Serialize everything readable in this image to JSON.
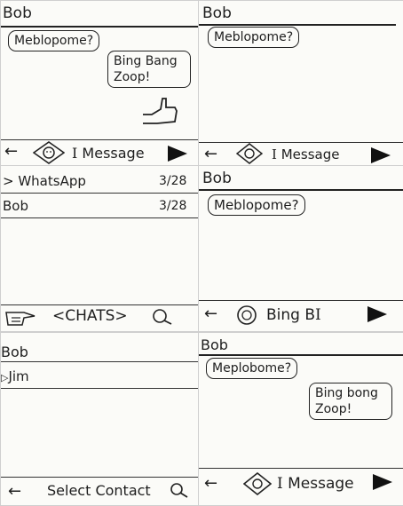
{
  "p1": {
    "contact": "Bob",
    "bubble_left": "Meblopome?",
    "bubble_right_line1": "Bing Bang",
    "bubble_right_line2": "Zoop!",
    "message_placeholder": "Message",
    "icons": [
      "back-arrow-icon",
      "emoji-icon",
      "text-cursor-icon",
      "send-icon",
      "thumbs-up-icon"
    ]
  },
  "p2": {
    "contact": "Bob",
    "bubble_left": "Meblopome?",
    "message_placeholder": "Message"
  },
  "p3": {
    "chats": [
      {
        "name": "> WhatsApp",
        "date": "3/28"
      },
      {
        "name": "Bob",
        "date": "3/28"
      }
    ],
    "bottom_label": "<CHATS>",
    "icons": [
      "pointing-hand-icon",
      "search-icon"
    ]
  },
  "p4": {
    "contact": "Bob",
    "bubble_left": "Meblopome?",
    "message_text": "Bing B",
    "icons": [
      "back-arrow-icon",
      "smiley-icon",
      "text-cursor-icon",
      "send-icon"
    ]
  },
  "p5": {
    "title": "Bob",
    "contacts": [
      "Jim"
    ],
    "bottom_label": "Select Contact",
    "icons": [
      "back-arrow-icon",
      "play-icon",
      "search-icon"
    ]
  },
  "p6": {
    "contact": "Bob",
    "bubble_left": "Meplobome?",
    "bubble_right_line1": "Bing bong",
    "bubble_right_line2": "Zoop!",
    "message_placeholder": "Message"
  }
}
